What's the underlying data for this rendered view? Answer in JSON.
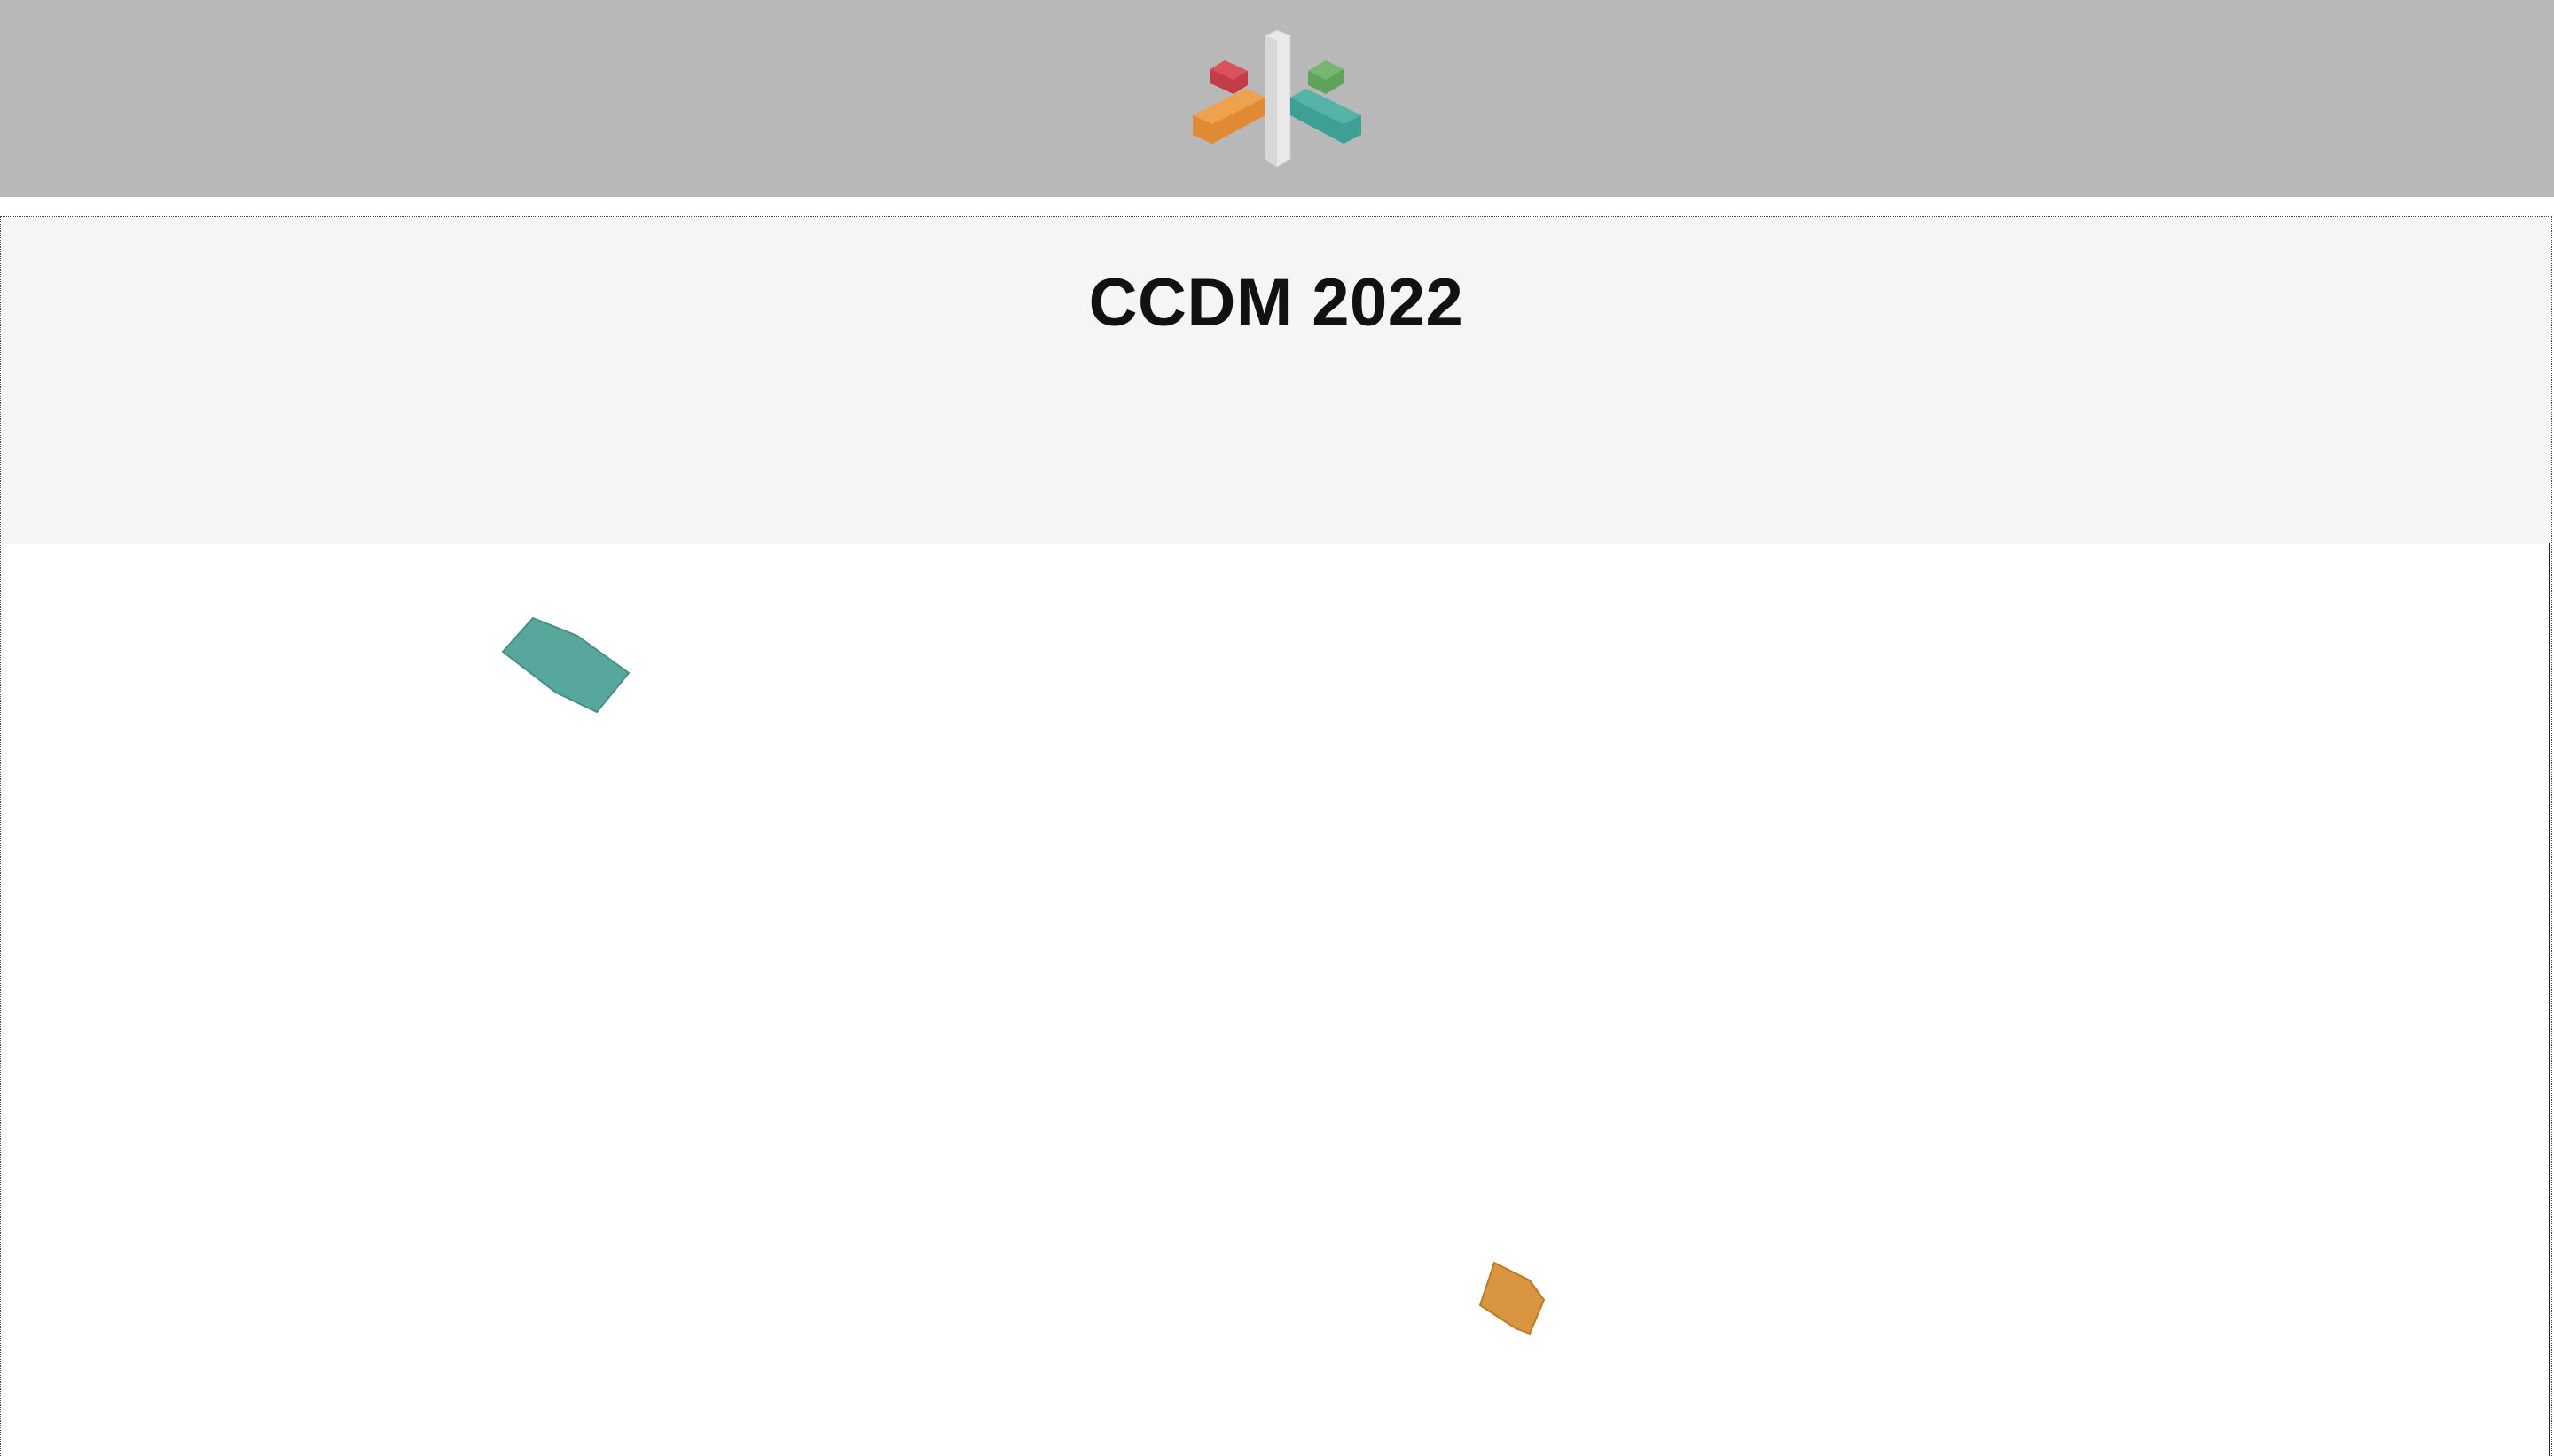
{
  "header": {
    "logo_icon": "colored-blocks-logo-icon",
    "logo_colors": {
      "red": "#c23b45",
      "green": "#5fa25a",
      "orange": "#e08a33",
      "teal": "#3e9f95",
      "white": "#f2f2f2"
    },
    "background": "#b8b8b8"
  },
  "hero": {
    "title": "CCDM 2022",
    "background": "#f5f5f5"
  },
  "decorations": {
    "teal_shape_color": "#57a79d",
    "orange_shape_color": "#d9953f"
  }
}
